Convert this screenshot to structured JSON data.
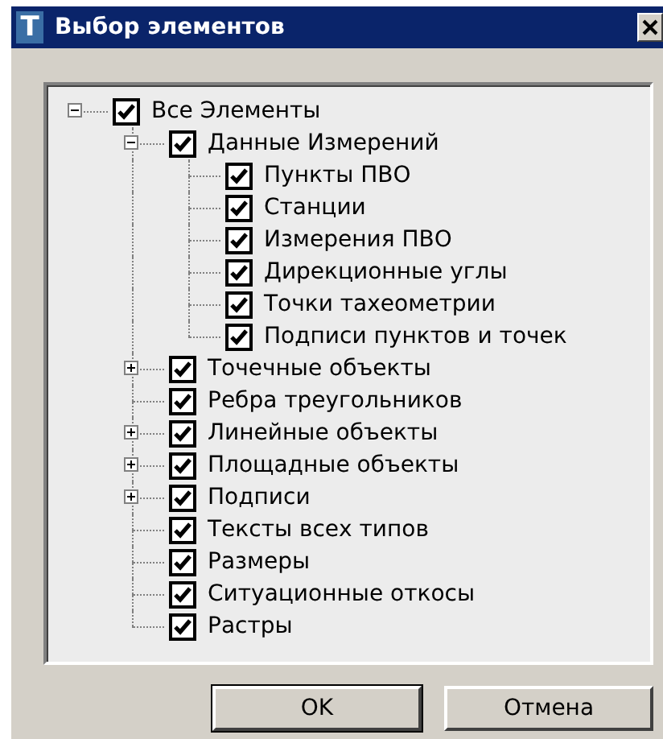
{
  "window": {
    "icon_letter": "T",
    "title": "Выбор элементов"
  },
  "tree": [
    {
      "label": "Все Элементы",
      "checked": true,
      "expanded": true,
      "children": [
        {
          "label": "Данные Измерений",
          "checked": true,
          "expanded": true,
          "children": [
            {
              "label": "Пункты ПВО",
              "checked": true
            },
            {
              "label": "Станции",
              "checked": true
            },
            {
              "label": "Измерения ПВО",
              "checked": true
            },
            {
              "label": "Дирекционные углы",
              "checked": true
            },
            {
              "label": "Точки тахеометрии",
              "checked": true
            },
            {
              "label": "Подписи пунктов и точек",
              "checked": true
            }
          ]
        },
        {
          "label": "Точечные объекты",
          "checked": true,
          "expanded": false
        },
        {
          "label": "Ребра треугольников",
          "checked": true
        },
        {
          "label": "Линейные объекты",
          "checked": true,
          "expanded": false
        },
        {
          "label": "Площадные объекты",
          "checked": true,
          "expanded": false
        },
        {
          "label": "Подписи",
          "checked": true,
          "expanded": false
        },
        {
          "label": "Тексты всех типов",
          "checked": true
        },
        {
          "label": "Размеры",
          "checked": true
        },
        {
          "label": "Ситуационные откосы",
          "checked": true
        },
        {
          "label": "Растры",
          "checked": true
        }
      ]
    }
  ],
  "buttons": [
    "OK",
    "Отмена"
  ]
}
